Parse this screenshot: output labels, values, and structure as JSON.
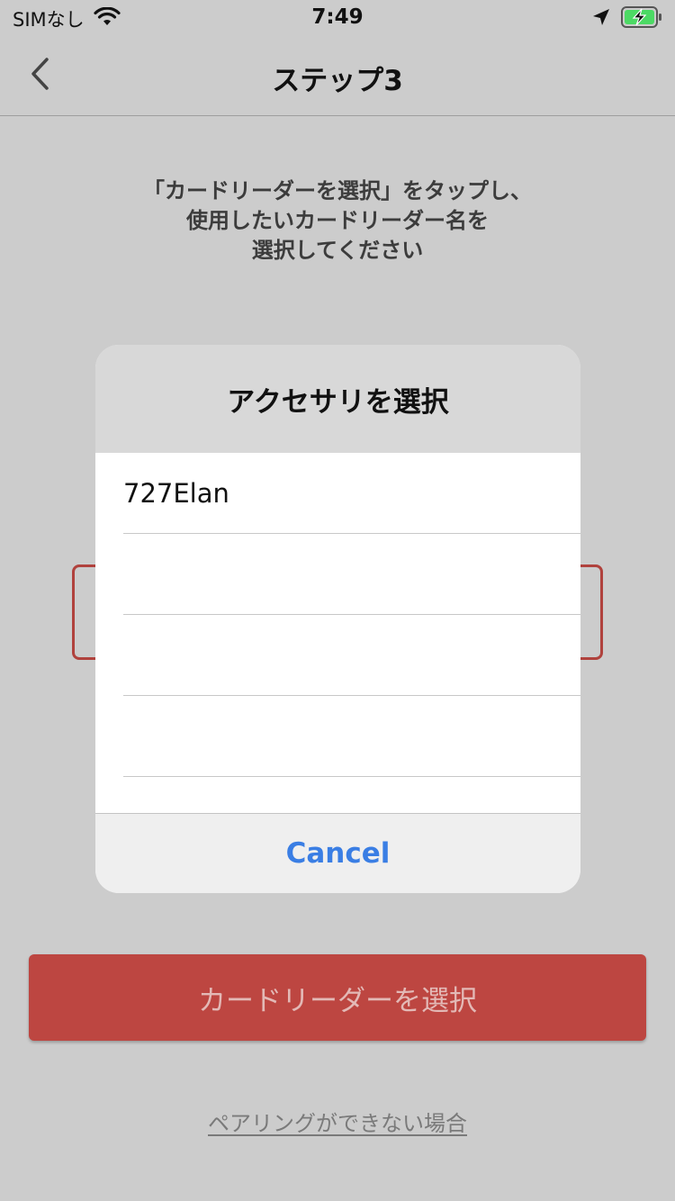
{
  "status_bar": {
    "carrier": "SIMなし",
    "time": "7:49",
    "icons": [
      "wifi-icon",
      "location-arrow-icon",
      "battery-charging-icon"
    ]
  },
  "nav": {
    "back_icon": "chevron-left-icon",
    "title": "ステップ3"
  },
  "instruction": {
    "lines": [
      "「カードリーダーを選択」をタップし、",
      "使用したいカードリーダー名を",
      "選択してください"
    ]
  },
  "alert": {
    "title": "アクセサリを選択",
    "items": [
      "727Elan",
      "",
      "",
      ""
    ],
    "cancel_label": "Cancel"
  },
  "select_button": {
    "label": "カードリーダーを選択"
  },
  "help_link": {
    "label": "ペアリングができない場合"
  },
  "colors": {
    "background": "#cccccc",
    "accent_red": "#bd4641",
    "link_blue": "#3a7ee4"
  }
}
